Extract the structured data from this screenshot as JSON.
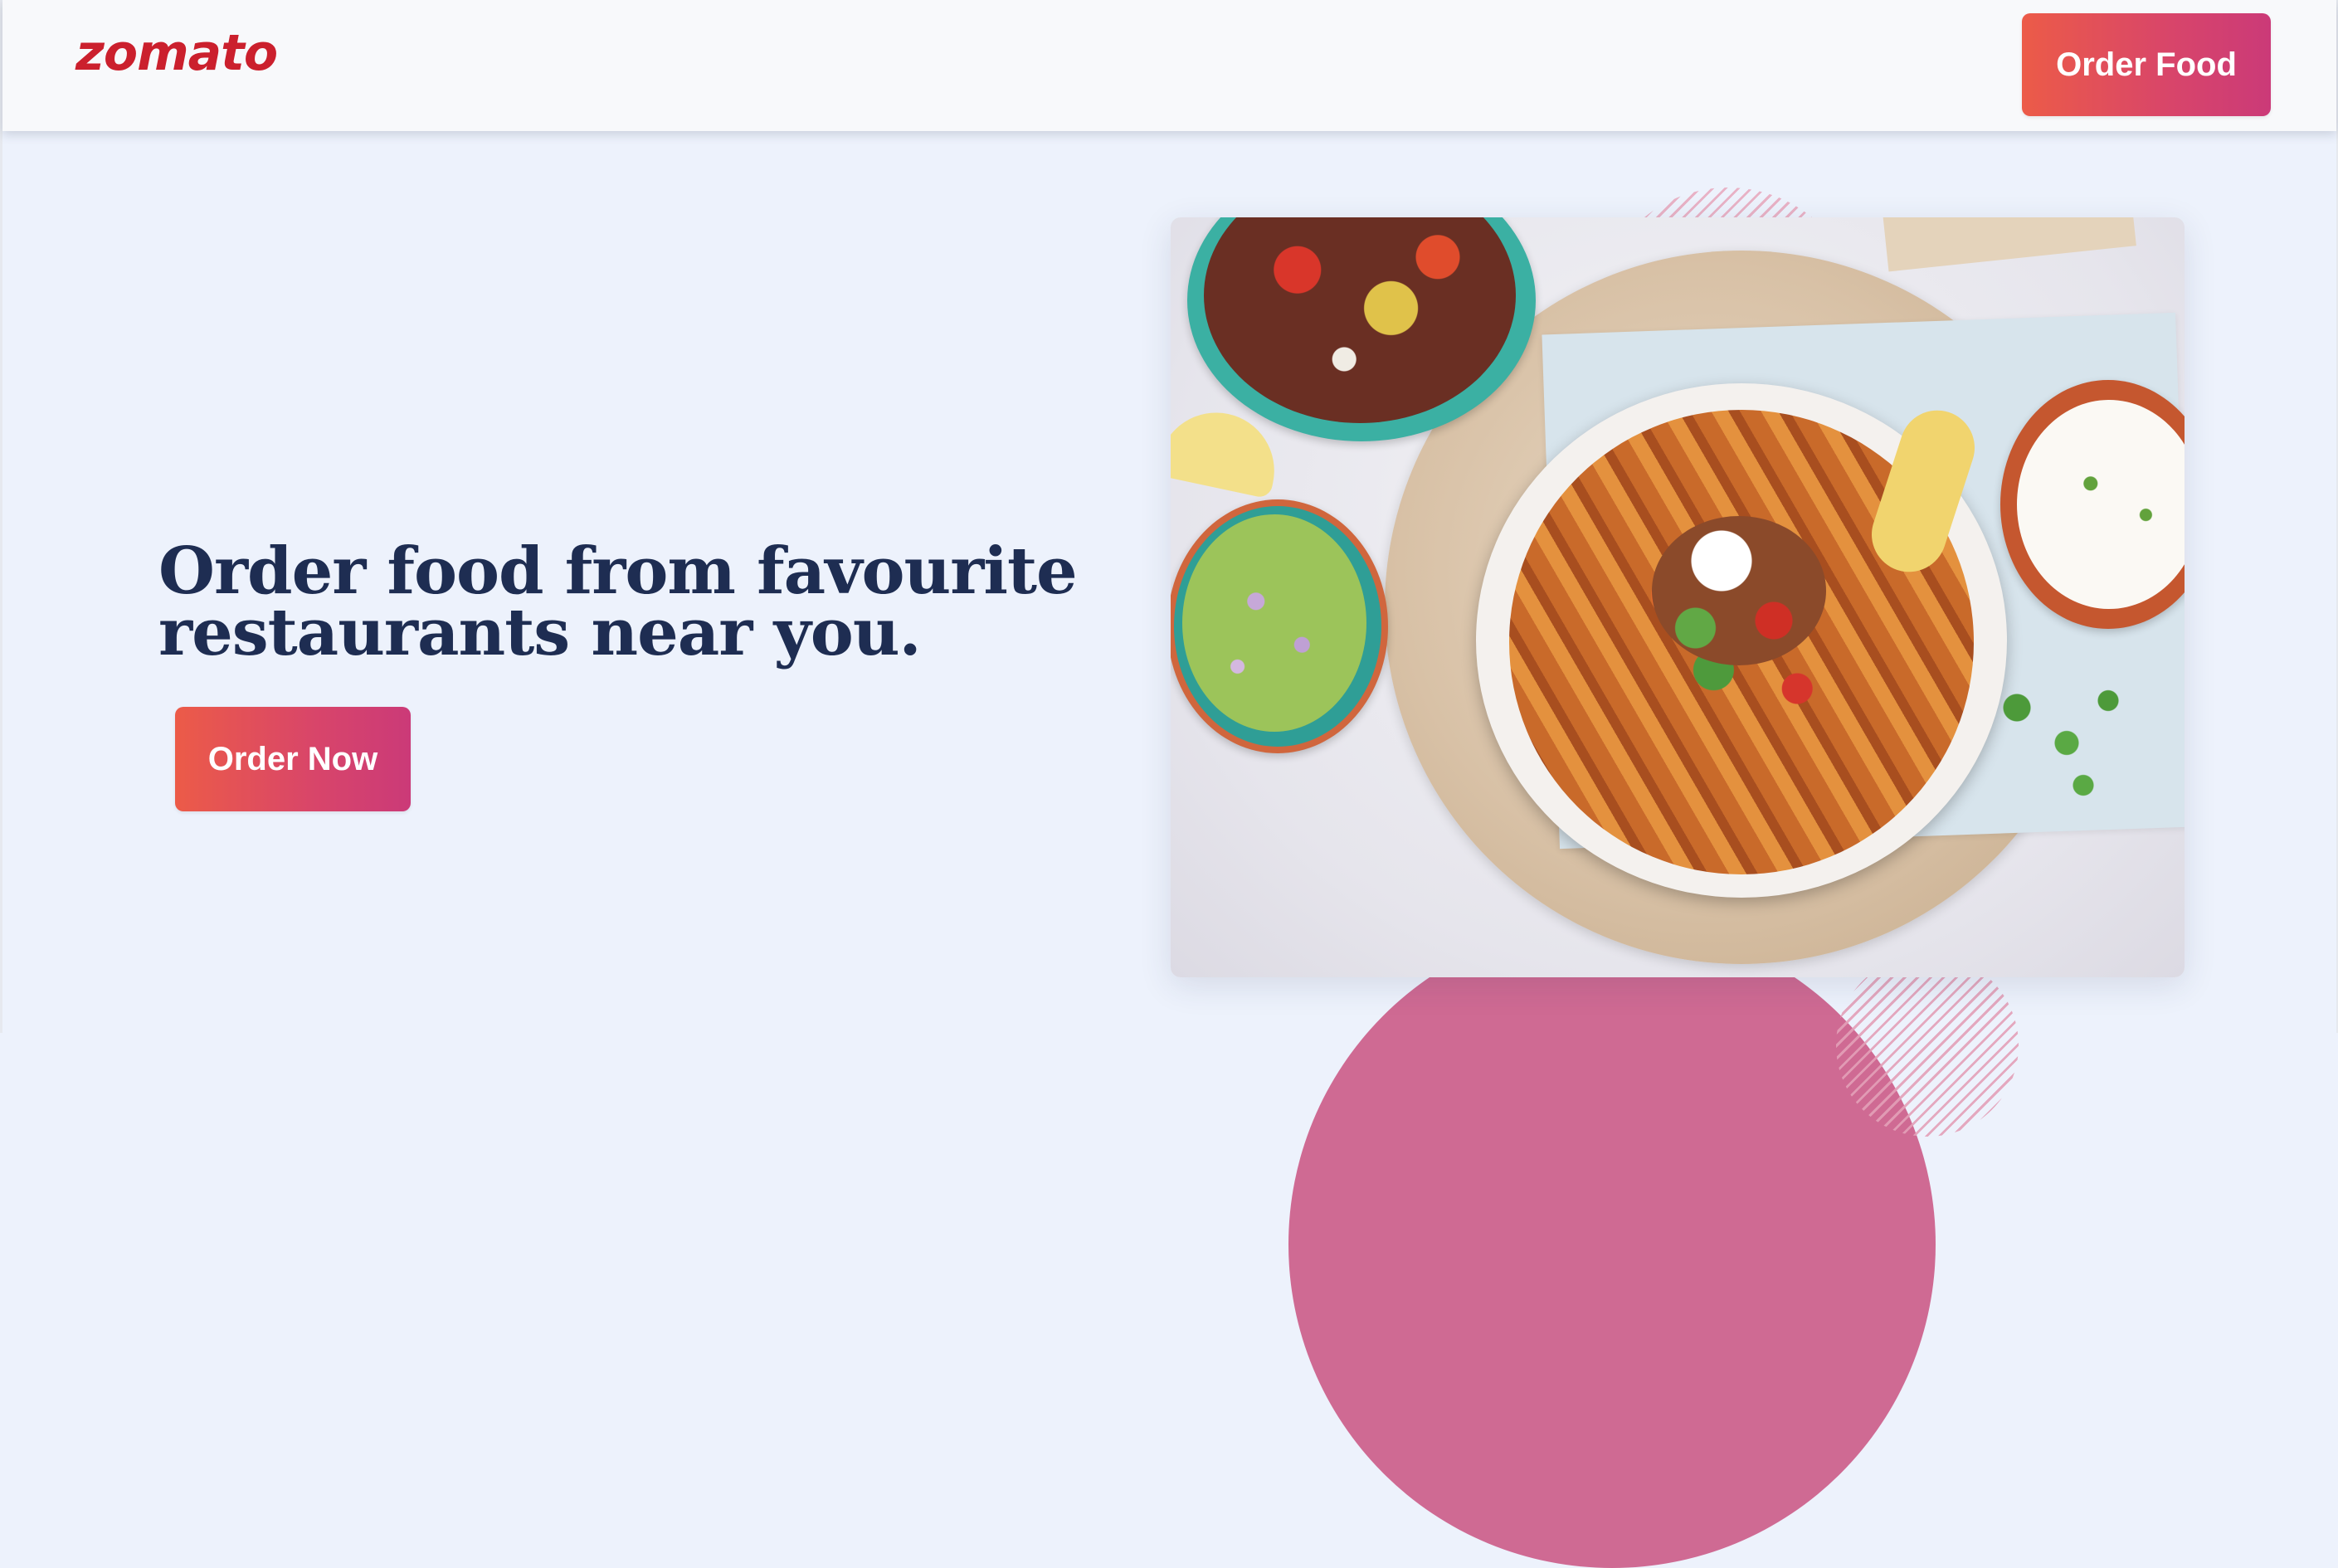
{
  "header": {
    "logo_text": "zomato",
    "order_food_label": "Order Food"
  },
  "hero": {
    "headline_line1": "Order food from favourite",
    "headline_line2": "restaurants near you.",
    "order_now_label": "Order Now",
    "image_alt": "Bowl of sweet potato fries with toppings, guacamole, sour cream and salsa"
  },
  "colors": {
    "brand": "#cb202d",
    "button_gradient_start": "#ec5b48",
    "button_gradient_end": "#cb3a78",
    "headline": "#1e2d52",
    "background": "#edf2fc",
    "header_background": "#f8f9fb",
    "accent_pink": "#cf6a93"
  }
}
